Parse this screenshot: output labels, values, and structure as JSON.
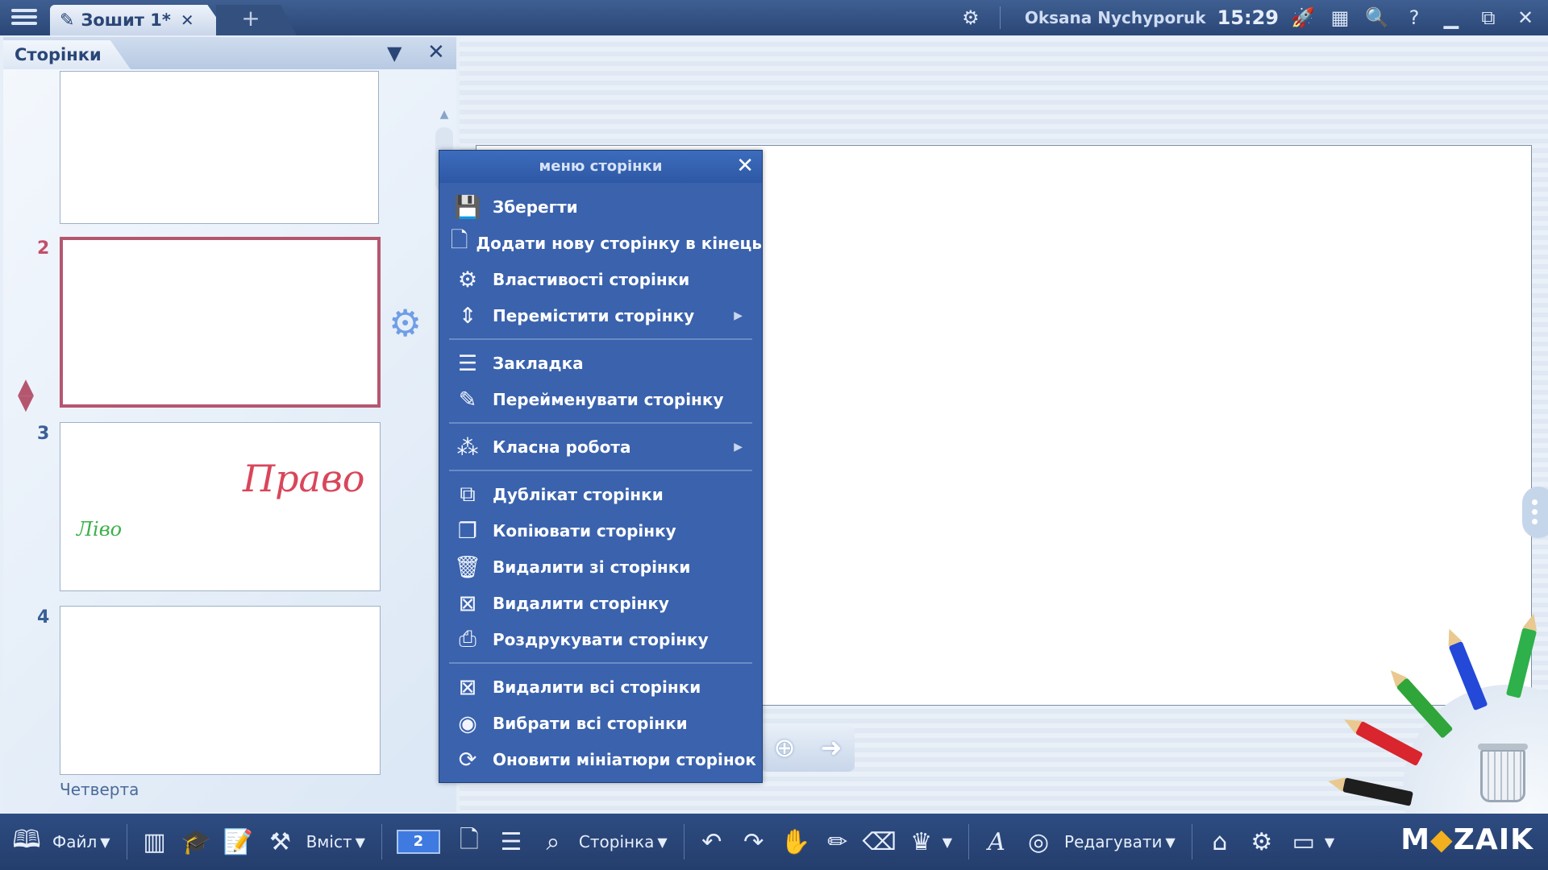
{
  "top_bar": {
    "doc_tab_title": "Зошит 1*",
    "user_name": "Oksana Nychyporuk",
    "clock": "15:29",
    "icons": [
      "menu-icon",
      "pencil-icon",
      "close-icon",
      "plus-icon",
      "gear-icon",
      "rocket-icon",
      "grid-icon",
      "search-icon",
      "help-icon",
      "minimize-icon",
      "restore-icon",
      "close-icon"
    ]
  },
  "pages_panel": {
    "title": "Сторінки",
    "pages": [
      {
        "number": "2"
      },
      {
        "number": "3"
      },
      {
        "number": "4",
        "caption": "Четверта"
      }
    ],
    "page3_handwriting": [
      "Право",
      "Ліво"
    ],
    "selected_page": "2"
  },
  "context_menu": {
    "title": "меню сторінки",
    "items": [
      {
        "label": "Зберегти",
        "icon": "save-icon"
      },
      {
        "label": "Додати нову сторінку в кінець",
        "icon": "add-page-icon"
      },
      {
        "label": "Властивості сторінки",
        "icon": "page-settings-icon"
      },
      {
        "label": "Перемістити сторінку",
        "icon": "move-icon",
        "submenu": true
      },
      {
        "label": "Закладка",
        "icon": "bookmark-icon"
      },
      {
        "label": "Перейменувати сторінку",
        "icon": "rename-icon"
      },
      {
        "label": "Класна робота",
        "icon": "classwork-icon",
        "submenu": true
      },
      {
        "label": "Дублікат сторінки",
        "icon": "duplicate-icon"
      },
      {
        "label": "Копіювати сторінку",
        "icon": "copy-icon"
      },
      {
        "label": "Видалити зі сторінки",
        "icon": "trash-icon"
      },
      {
        "label": "Видалити сторінку",
        "icon": "delete-page-icon"
      },
      {
        "label": "Роздрукувати сторінку",
        "icon": "print-icon"
      },
      {
        "label": "Видалити всі сторінки",
        "icon": "delete-all-icon"
      },
      {
        "label": "Вибрати всі сторінки",
        "icon": "select-all-icon"
      },
      {
        "label": "Оновити мініатюри сторінок",
        "icon": "refresh-icon"
      }
    ]
  },
  "bottom_bar": {
    "file_label": "Файл",
    "content_label": "Вміст",
    "page_number": "2",
    "page_label": "Сторінка",
    "edit_label": "Редагувати",
    "logo": [
      "M",
      "◆",
      "ZAIK"
    ]
  },
  "colors": {
    "accent_blue": "#3a62ad",
    "selected_border": "#b5566f",
    "topbar": "#2a4676"
  }
}
